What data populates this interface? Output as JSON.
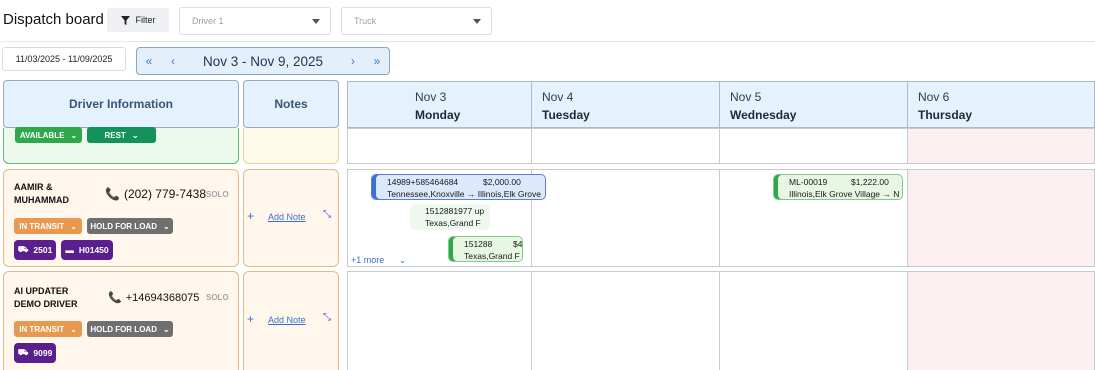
{
  "header": {
    "title": "Dispatch board",
    "filter_label": "Filter",
    "driver_placeholder": "Driver 1",
    "truck_placeholder": "Truck"
  },
  "dates": {
    "range": "11/03/2025 - 11/09/2025",
    "week_label": "Nov 3 - Nov 9, 2025",
    "nav_first": "«",
    "nav_prev": "‹",
    "nav_next": "›",
    "nav_last": "»"
  },
  "columns": {
    "driver_info": "Driver Information",
    "notes": "Notes"
  },
  "days": [
    {
      "date": "Nov 3",
      "weekday": "Monday"
    },
    {
      "date": "Nov 4",
      "weekday": "Tuesday"
    },
    {
      "date": "Nov 5",
      "weekday": "Wednesday"
    },
    {
      "date": "Nov 6",
      "weekday": "Thursday"
    }
  ],
  "row0": {
    "status1": "AVAILABLE",
    "status2": "REST"
  },
  "row1": {
    "name": "AAMIR & MUHAMMAD",
    "phone": "(202) 779-7438",
    "type": "SOLO",
    "status1": "IN TRANSIT",
    "status2": "HOLD FOR LOAD",
    "truck": "2501",
    "trailer": "H01450",
    "add_note": "Add Note",
    "loads": [
      {
        "id": "14989+585464684",
        "amount": "$2,000.00",
        "route": "Tennessee,Knoxville → Illinois,Elk Grove"
      },
      {
        "id": "1512881977 up",
        "route": "Texas,Grand F"
      },
      {
        "id": "151288",
        "amount": "$4",
        "route": "Texas,Grand F"
      },
      {
        "id": "ML-00019",
        "amount": "$1,222.00",
        "route": "Illinois,Elk Grove Village → N"
      }
    ],
    "more": "+1 more"
  },
  "row2": {
    "name": "AI UPDATER DEMO DRIVER",
    "phone": "+14694368075",
    "type": "SOLO",
    "status1": "IN TRANSIT",
    "status2": "HOLD FOR LOAD",
    "truck": "9099",
    "add_note": "Add Note"
  }
}
